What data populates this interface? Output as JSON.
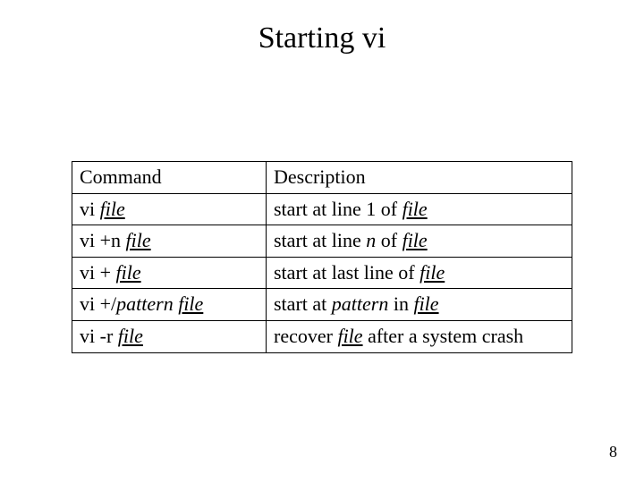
{
  "title": "Starting vi",
  "headers": {
    "col1": "Command",
    "col2": "Description"
  },
  "rows": [
    {
      "cmd": [
        {
          "t": "vi "
        },
        {
          "t": "file",
          "iu": true
        }
      ],
      "desc": [
        {
          "t": "start at line 1 of "
        },
        {
          "t": "file",
          "iu": true
        }
      ]
    },
    {
      "cmd": [
        {
          "t": "vi +n "
        },
        {
          "t": "file",
          "iu": true
        }
      ],
      "desc": [
        {
          "t": "start at line "
        },
        {
          "t": "n",
          "i": true
        },
        {
          "t": " of "
        },
        {
          "t": "file",
          "iu": true
        }
      ]
    },
    {
      "cmd": [
        {
          "t": "vi + "
        },
        {
          "t": "file",
          "iu": true
        }
      ],
      "desc": [
        {
          "t": "start at last line of "
        },
        {
          "t": "file",
          "iu": true
        }
      ]
    },
    {
      "cmd": [
        {
          "t": "vi +/"
        },
        {
          "t": "pattern",
          "i": true
        },
        {
          "t": " "
        },
        {
          "t": "file",
          "iu": true
        }
      ],
      "desc": [
        {
          "t": "start at "
        },
        {
          "t": "pattern",
          "i": true
        },
        {
          "t": " in "
        },
        {
          "t": "file",
          "iu": true
        }
      ]
    },
    {
      "cmd": [
        {
          "t": "vi -r "
        },
        {
          "t": "file",
          "iu": true
        }
      ],
      "desc": [
        {
          "t": "recover "
        },
        {
          "t": "file",
          "iu": true
        },
        {
          "t": " after a system crash"
        }
      ]
    }
  ],
  "page_number": "8"
}
